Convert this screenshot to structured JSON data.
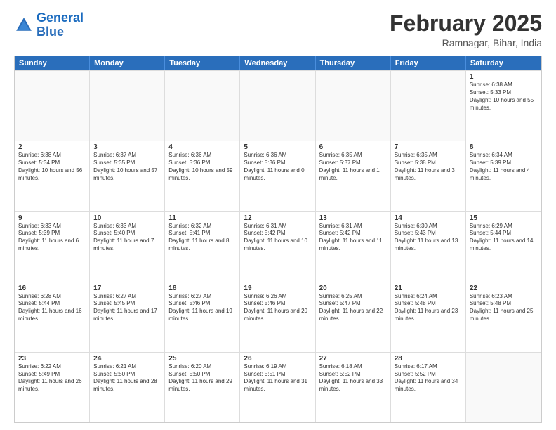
{
  "logo": {
    "line1": "General",
    "line2": "Blue"
  },
  "title": "February 2025",
  "subtitle": "Ramnagar, Bihar, India",
  "header_days": [
    "Sunday",
    "Monday",
    "Tuesday",
    "Wednesday",
    "Thursday",
    "Friday",
    "Saturday"
  ],
  "weeks": [
    [
      {
        "day": "",
        "info": ""
      },
      {
        "day": "",
        "info": ""
      },
      {
        "day": "",
        "info": ""
      },
      {
        "day": "",
        "info": ""
      },
      {
        "day": "",
        "info": ""
      },
      {
        "day": "",
        "info": ""
      },
      {
        "day": "1",
        "info": "Sunrise: 6:38 AM\nSunset: 5:33 PM\nDaylight: 10 hours and 55 minutes."
      }
    ],
    [
      {
        "day": "2",
        "info": "Sunrise: 6:38 AM\nSunset: 5:34 PM\nDaylight: 10 hours and 56 minutes."
      },
      {
        "day": "3",
        "info": "Sunrise: 6:37 AM\nSunset: 5:35 PM\nDaylight: 10 hours and 57 minutes."
      },
      {
        "day": "4",
        "info": "Sunrise: 6:36 AM\nSunset: 5:36 PM\nDaylight: 10 hours and 59 minutes."
      },
      {
        "day": "5",
        "info": "Sunrise: 6:36 AM\nSunset: 5:36 PM\nDaylight: 11 hours and 0 minutes."
      },
      {
        "day": "6",
        "info": "Sunrise: 6:35 AM\nSunset: 5:37 PM\nDaylight: 11 hours and 1 minute."
      },
      {
        "day": "7",
        "info": "Sunrise: 6:35 AM\nSunset: 5:38 PM\nDaylight: 11 hours and 3 minutes."
      },
      {
        "day": "8",
        "info": "Sunrise: 6:34 AM\nSunset: 5:39 PM\nDaylight: 11 hours and 4 minutes."
      }
    ],
    [
      {
        "day": "9",
        "info": "Sunrise: 6:33 AM\nSunset: 5:39 PM\nDaylight: 11 hours and 6 minutes."
      },
      {
        "day": "10",
        "info": "Sunrise: 6:33 AM\nSunset: 5:40 PM\nDaylight: 11 hours and 7 minutes."
      },
      {
        "day": "11",
        "info": "Sunrise: 6:32 AM\nSunset: 5:41 PM\nDaylight: 11 hours and 8 minutes."
      },
      {
        "day": "12",
        "info": "Sunrise: 6:31 AM\nSunset: 5:42 PM\nDaylight: 11 hours and 10 minutes."
      },
      {
        "day": "13",
        "info": "Sunrise: 6:31 AM\nSunset: 5:42 PM\nDaylight: 11 hours and 11 minutes."
      },
      {
        "day": "14",
        "info": "Sunrise: 6:30 AM\nSunset: 5:43 PM\nDaylight: 11 hours and 13 minutes."
      },
      {
        "day": "15",
        "info": "Sunrise: 6:29 AM\nSunset: 5:44 PM\nDaylight: 11 hours and 14 minutes."
      }
    ],
    [
      {
        "day": "16",
        "info": "Sunrise: 6:28 AM\nSunset: 5:44 PM\nDaylight: 11 hours and 16 minutes."
      },
      {
        "day": "17",
        "info": "Sunrise: 6:27 AM\nSunset: 5:45 PM\nDaylight: 11 hours and 17 minutes."
      },
      {
        "day": "18",
        "info": "Sunrise: 6:27 AM\nSunset: 5:46 PM\nDaylight: 11 hours and 19 minutes."
      },
      {
        "day": "19",
        "info": "Sunrise: 6:26 AM\nSunset: 5:46 PM\nDaylight: 11 hours and 20 minutes."
      },
      {
        "day": "20",
        "info": "Sunrise: 6:25 AM\nSunset: 5:47 PM\nDaylight: 11 hours and 22 minutes."
      },
      {
        "day": "21",
        "info": "Sunrise: 6:24 AM\nSunset: 5:48 PM\nDaylight: 11 hours and 23 minutes."
      },
      {
        "day": "22",
        "info": "Sunrise: 6:23 AM\nSunset: 5:48 PM\nDaylight: 11 hours and 25 minutes."
      }
    ],
    [
      {
        "day": "23",
        "info": "Sunrise: 6:22 AM\nSunset: 5:49 PM\nDaylight: 11 hours and 26 minutes."
      },
      {
        "day": "24",
        "info": "Sunrise: 6:21 AM\nSunset: 5:50 PM\nDaylight: 11 hours and 28 minutes."
      },
      {
        "day": "25",
        "info": "Sunrise: 6:20 AM\nSunset: 5:50 PM\nDaylight: 11 hours and 29 minutes."
      },
      {
        "day": "26",
        "info": "Sunrise: 6:19 AM\nSunset: 5:51 PM\nDaylight: 11 hours and 31 minutes."
      },
      {
        "day": "27",
        "info": "Sunrise: 6:18 AM\nSunset: 5:52 PM\nDaylight: 11 hours and 33 minutes."
      },
      {
        "day": "28",
        "info": "Sunrise: 6:17 AM\nSunset: 5:52 PM\nDaylight: 11 hours and 34 minutes."
      },
      {
        "day": "",
        "info": ""
      }
    ]
  ]
}
